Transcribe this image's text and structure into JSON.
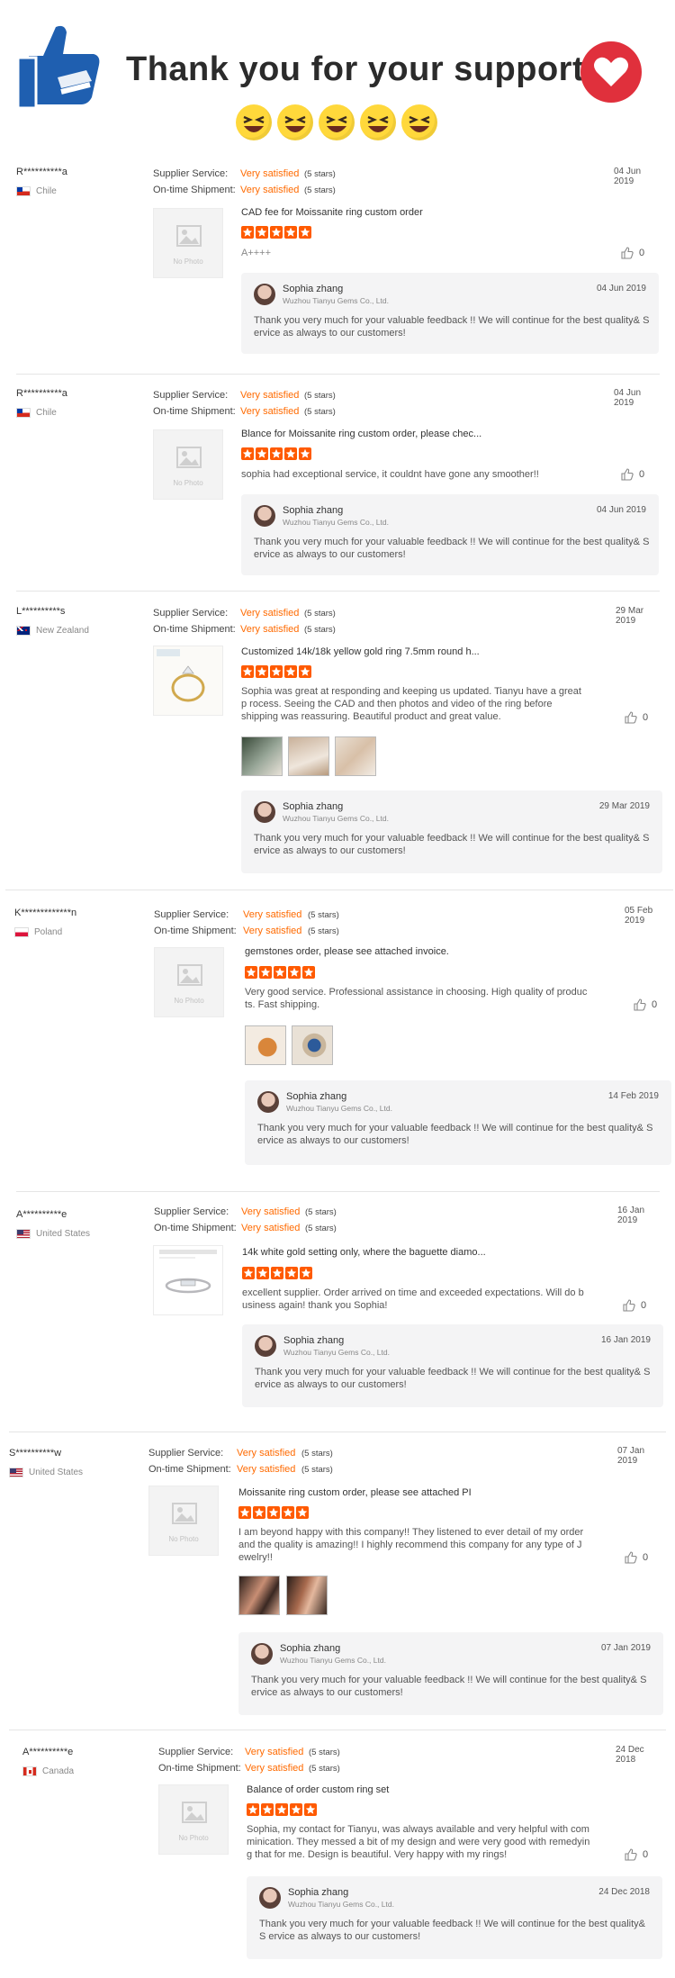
{
  "banner": {
    "title": "Thank you for your support."
  },
  "rating_labels": {
    "supplier": "Supplier Service:",
    "shipment": "On-time Shipment:"
  },
  "no_photo": "No Photo",
  "reviews": [
    {
      "buyer": "R**********a",
      "country": "Chile",
      "date": "04 Jun 2019",
      "supplier_rating": "Very satisfied",
      "supplier_stars": "(5 stars)",
      "shipment_rating": "Very satisfied",
      "shipment_stars": "(5 stars)",
      "product": "CAD fee for Moissanite ring custom order",
      "comment": "A++++",
      "likes": "0",
      "reply": {
        "name": "Sophia zhang",
        "company": "Wuzhou Tianyu Gems Co., Ltd.",
        "date": "04 Jun 2019",
        "text": "Thank you very much for your valuable feedback !!  We will continue for the best quality& S ervice as always to our customers!"
      }
    },
    {
      "buyer": "R**********a",
      "country": "Chile",
      "date": "04 Jun 2019",
      "supplier_rating": "Very satisfied",
      "supplier_stars": "(5 stars)",
      "shipment_rating": "Very satisfied",
      "shipment_stars": "(5 stars)",
      "product": "Blance for Moissanite ring custom order, please chec...",
      "comment": "sophia had exceptional service, it couldnt have gone any smoother!!",
      "likes": "0",
      "reply": {
        "name": "Sophia zhang",
        "company": "Wuzhou Tianyu Gems Co., Ltd.",
        "date": "04 Jun 2019",
        "text": "Thank you very much for your valuable feedback !!  We will continue for the best quality& S ervice as always to our customers!"
      }
    },
    {
      "buyer": "L**********s",
      "country": "New Zealand",
      "date": "29 Mar 2019",
      "supplier_rating": "Very satisfied",
      "supplier_stars": "(5 stars)",
      "shipment_rating": "Very satisfied",
      "shipment_stars": "(5 stars)",
      "product": "Customized 14k/18k yellow gold ring 7.5mm round h...",
      "comment": "Sophia was great at responding and keeping us updated. Tianyu have a great p rocess. Seeing the CAD and then photos and video of the ring before shipping was reassuring. Beautiful product and great value.",
      "likes": "0",
      "reply": {
        "name": "Sophia zhang",
        "company": "Wuzhou Tianyu Gems Co., Ltd.",
        "date": "29 Mar 2019",
        "text": "Thank you very much for your valuable feedback !!  We will continue for the best quality& S ervice as always to our customers!"
      }
    },
    {
      "buyer": "K*************n",
      "country": "Poland",
      "date": "05 Feb 2019",
      "supplier_rating": "Very satisfied",
      "supplier_stars": "(5 stars)",
      "shipment_rating": "Very satisfied",
      "shipment_stars": "(5 stars)",
      "product": "gemstones order, please see attached invoice.",
      "comment": "Very good service. Professional assistance in choosing. High quality of produc ts. Fast shipping.",
      "likes": "0",
      "reply": {
        "name": "Sophia zhang",
        "company": "Wuzhou Tianyu Gems Co., Ltd.",
        "date": "14 Feb 2019",
        "text": "Thank you very much for your valuable feedback !!  We will continue for the best quality& S ervice as always to our customers!"
      }
    },
    {
      "buyer": "A**********e",
      "country": "United States",
      "date": "16 Jan 2019",
      "supplier_rating": "Very satisfied",
      "supplier_stars": "(5 stars)",
      "shipment_rating": "Very satisfied",
      "shipment_stars": "(5 stars)",
      "product": "14k white gold setting only, where the baguette diamo...",
      "comment": "excellent supplier.  Order arrived on time and exceeded expectations.  Will do b usiness again!  thank you Sophia!",
      "likes": "0",
      "reply": {
        "name": "Sophia zhang",
        "company": "Wuzhou Tianyu Gems Co., Ltd.",
        "date": "16 Jan 2019",
        "text": "Thank you very much for your valuable feedback !!  We will continue for the best quality& S ervice as always to our customers!"
      }
    },
    {
      "buyer": "S**********w",
      "country": "United States",
      "date": "07 Jan 2019",
      "supplier_rating": "Very satisfied",
      "supplier_stars": "(5 stars)",
      "shipment_rating": "Very satisfied",
      "shipment_stars": "(5 stars)",
      "product": "Moissanite ring custom order, please see attached PI",
      "comment": "I am beyond happy with this company!! They listened to ever detail of my order and the quality is amazing!! I highly recommend this company for any type of J ewelry!!",
      "likes": "0",
      "reply": {
        "name": "Sophia zhang",
        "company": "Wuzhou Tianyu Gems Co., Ltd.",
        "date": "07 Jan 2019",
        "text": "Thank you very much for your valuable feedback !!  We will continue for the best quality& S ervice as always to our customers!"
      }
    },
    {
      "buyer": "A**********e",
      "country": "Canada",
      "date": "24 Dec 2018",
      "supplier_rating": "Very satisfied",
      "supplier_stars": "(5 stars)",
      "shipment_rating": "Very satisfied",
      "shipment_stars": "(5 stars)",
      "product": "Balance of order custom ring set",
      "comment": "Sophia, my contact for Tianyu, was always available and very helpful with com minication. They messed a bit of my design and were very good with remedyin g that for me. Design is beautiful. Very happy with my rings!",
      "likes": "0",
      "reply": {
        "name": "Sophia zhang",
        "company": "Wuzhou Tianyu Gems Co., Ltd.",
        "date": "24 Dec 2018",
        "text": "Thank you very much for your valuable feedback !!  We will continue for the best quality& S ervice as always to our customers!"
      }
    }
  ]
}
